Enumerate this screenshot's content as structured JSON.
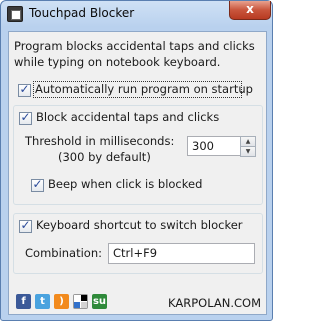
{
  "window": {
    "title": "Touchpad Blocker",
    "close_label": "x"
  },
  "description": "Program blocks accidental taps and clicks while typing on notebook keyboard.",
  "options": {
    "autorun": {
      "label": "Automatically run program on startup",
      "checked": true
    },
    "block_taps": {
      "label": "Block accidental taps and clicks",
      "checked": true
    },
    "threshold": {
      "label": "Threshold in milliseconds:",
      "default_note": "(300 by default)",
      "value": "300"
    },
    "beep": {
      "label": "Beep when click is blocked",
      "checked": true
    },
    "shortcut": {
      "label": "Keyboard shortcut to switch blocker",
      "checked": true
    },
    "combination": {
      "label": "Combination:",
      "value": "Ctrl+F9"
    }
  },
  "footer": {
    "social_icons": [
      "facebook-icon",
      "twitter-icon",
      "rss-icon",
      "delicious-icon",
      "stumbleupon-icon"
    ],
    "site": "KARPOLAN.COM"
  },
  "colors": {
    "frame": "#b9d1ee",
    "close_button": "#c9553c",
    "facebook": "#3b5998",
    "twitter": "#4aa3df",
    "rss": "#f28a1d",
    "stumbleupon": "#2f8a3a"
  }
}
